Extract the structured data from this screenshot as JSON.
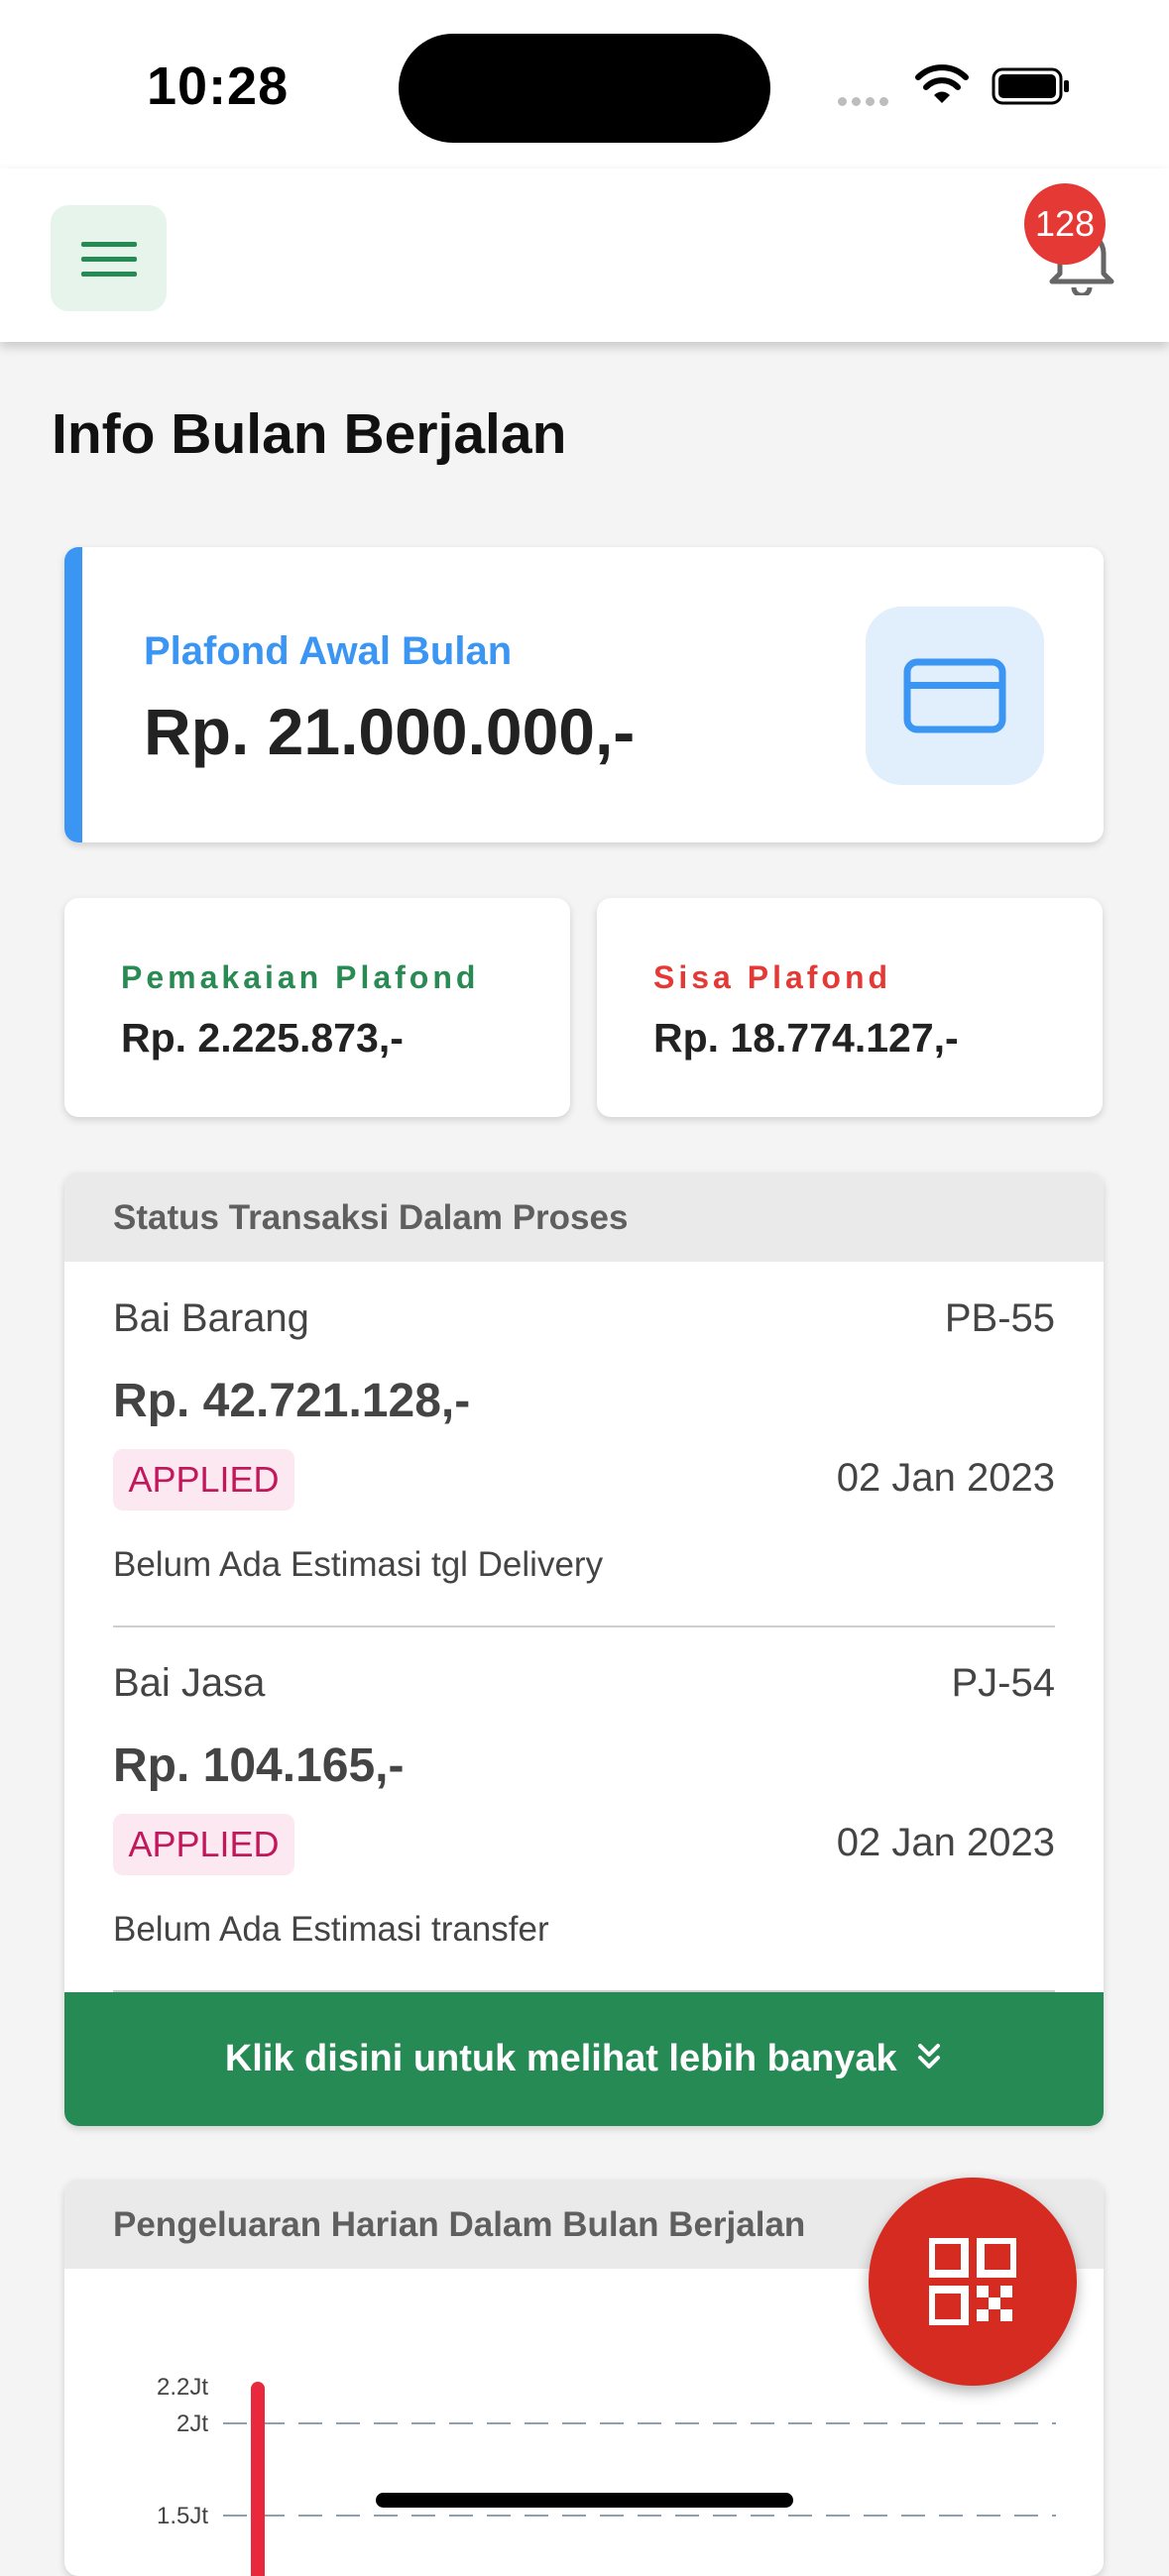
{
  "status_bar": {
    "time": "10:28"
  },
  "header": {
    "notification_count": "128"
  },
  "page_title": "Info Bulan Berjalan",
  "plafond": {
    "label": "Plafond Awal Bulan",
    "value": "Rp. 21.000.000,-"
  },
  "usage": {
    "used_label": "Pemakaian Plafond",
    "used_value": "Rp. 2.225.873,-",
    "remaining_label": "Sisa Plafond",
    "remaining_value": "Rp. 18.774.127,-"
  },
  "transactions": {
    "title": "Status Transaksi Dalam Proses",
    "items": [
      {
        "type": "Bai Barang",
        "code": "PB-55",
        "amount": "Rp. 42.721.128,-",
        "status": "APPLIED",
        "date": "02 Jan 2023",
        "note": "Belum Ada Estimasi tgl Delivery"
      },
      {
        "type": "Bai Jasa",
        "code": "PJ-54",
        "amount": "Rp. 104.165,-",
        "status": "APPLIED",
        "date": "02 Jan 2023",
        "note": "Belum Ada Estimasi transfer"
      }
    ],
    "more_label": "Klik disini untuk melihat lebih banyak"
  },
  "chart_panel": {
    "title": "Pengeluaran Harian Dalam Bulan Berjalan"
  },
  "chart_data": {
    "type": "bar",
    "title": "Pengeluaran Harian Dalam Bulan Berjalan",
    "ytick_labels": [
      "2.2Jt",
      "2Jt",
      "1.5Jt"
    ],
    "ytick_values": [
      2200000,
      2000000,
      1500000
    ],
    "ylim": [
      1500000,
      2200000
    ],
    "grid": true,
    "series": [
      {
        "values": [
          2225873
        ]
      }
    ],
    "colors": {
      "bar": "#e8283c",
      "grid": "#8fa0b0"
    }
  },
  "colors": {
    "accent_blue": "#3b95f2",
    "green": "#268a55",
    "red": "#e53935",
    "badge_pink": "#c2185b"
  }
}
